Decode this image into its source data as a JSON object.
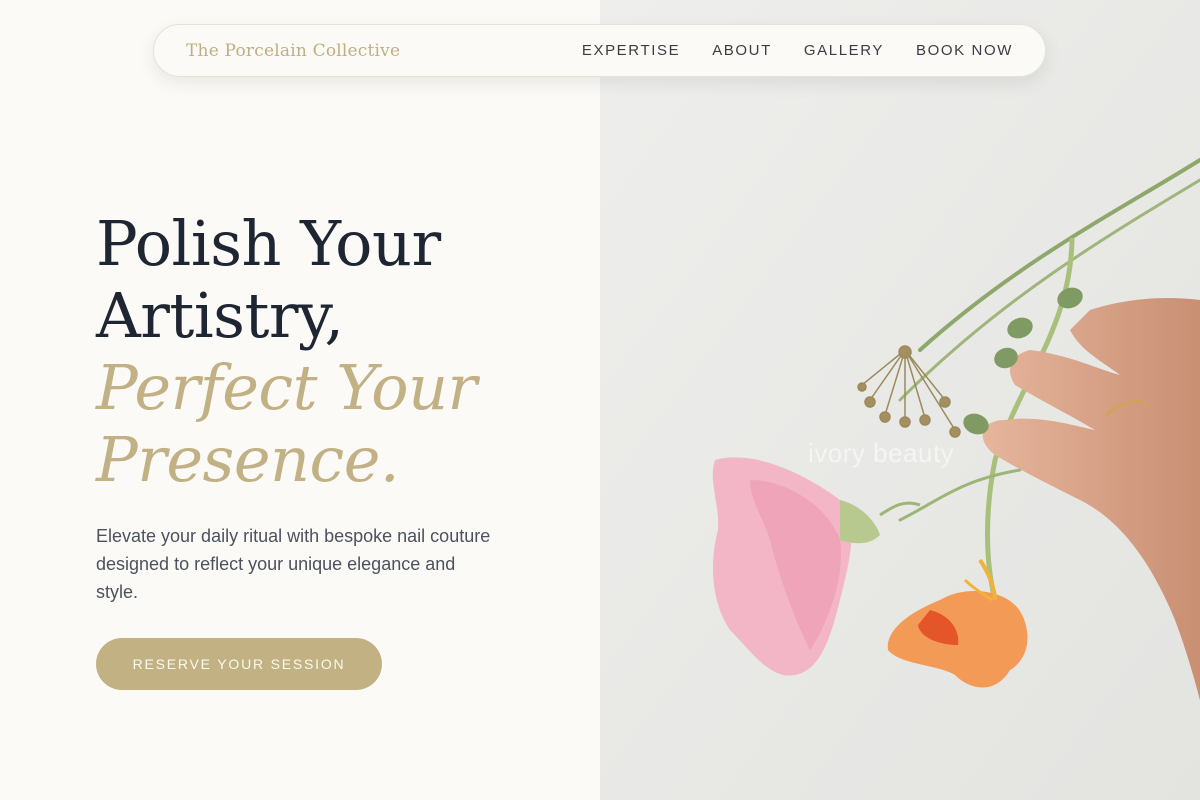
{
  "nav": {
    "brand": "The Porcelain Collective",
    "links": [
      "EXPERTISE",
      "ABOUT",
      "GALLERY",
      "BOOK NOW"
    ]
  },
  "hero": {
    "headline_lines": [
      "Polish Your",
      "Artistry,"
    ],
    "headline_accent_lines": [
      "Perfect Your",
      "Presence."
    ],
    "subtext": "Elevate your daily ritual with bespoke nail couture designed to reflect your unique elegance and style.",
    "cta_label": "RESERVE YOUR SESSION"
  },
  "image": {
    "watermark": "ivory beauty"
  },
  "colors": {
    "accent_gold": "#c2b283",
    "heading_navy": "#1f2633",
    "background": "#fbfaf7",
    "nail_green": "#7f9a63"
  }
}
